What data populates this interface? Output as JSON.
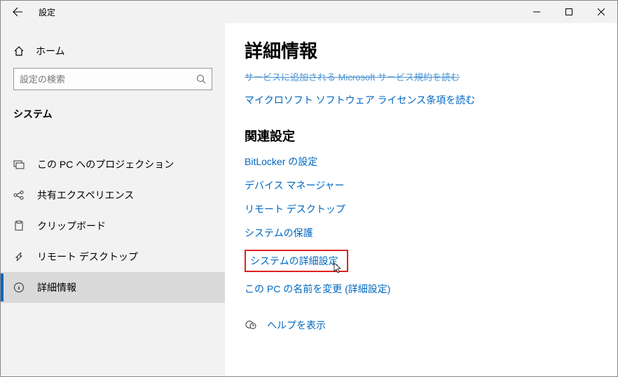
{
  "window": {
    "title": "設定"
  },
  "sidebar": {
    "home": "ホーム",
    "search_placeholder": "設定の検索",
    "category": "システム",
    "items": [
      {
        "icon": "project",
        "label": "この PC へのプロジェクション"
      },
      {
        "icon": "share",
        "label": "共有エクスペリエンス"
      },
      {
        "icon": "clipboard",
        "label": "クリップボード"
      },
      {
        "icon": "remote",
        "label": "リモート デスクトップ"
      },
      {
        "icon": "info",
        "label": "詳細情報"
      }
    ]
  },
  "main": {
    "heading": "詳細情報",
    "cutoff": "サービスに追加される Microsoft サービス規約を読む",
    "license_link": "マイクロソフト ソフトウェア ライセンス条項を読む",
    "related_heading": "関連設定",
    "related": [
      "BitLocker の設定",
      "デバイス マネージャー",
      "リモート デスクトップ",
      "システムの保護",
      "システムの詳細設定",
      "この PC の名前を変更 (詳細設定)"
    ],
    "help": "ヘルプを表示"
  }
}
